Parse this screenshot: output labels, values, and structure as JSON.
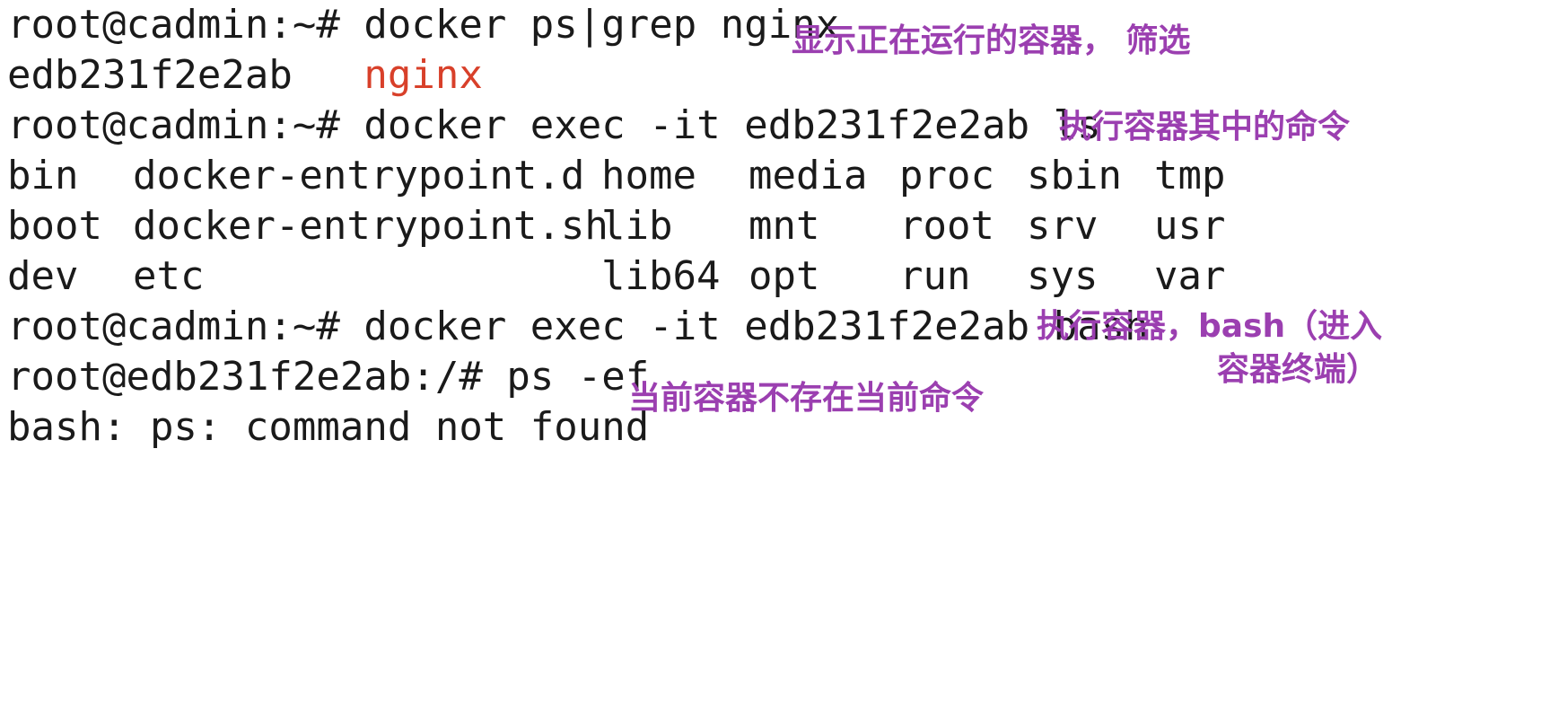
{
  "colors": {
    "background": "#ffffff",
    "terminal_text": "#1a1a1a",
    "grep_highlight": "#d8402a",
    "annotation": "#9b3fb0"
  },
  "terminal": {
    "cmd1": {
      "prompt": "root@cadmin:~#",
      "command": "docker ps|grep nginx"
    },
    "out1": {
      "container_id": "edb231f2e2ab",
      "match": "nginx"
    },
    "cmd2": {
      "prompt": "root@cadmin:~#",
      "command": "docker exec -it edb231f2e2ab ls"
    },
    "ls_rows": [
      [
        "bin",
        "docker-entrypoint.d",
        "home",
        "media",
        "proc",
        "sbin",
        "tmp"
      ],
      [
        "boot",
        "docker-entrypoint.sh",
        "lib",
        "mnt",
        "root",
        "srv",
        "usr"
      ],
      [
        "dev",
        "etc",
        "lib64",
        "opt",
        "run",
        "sys",
        "var"
      ]
    ],
    "cmd3": {
      "prompt": "root@cadmin:~#",
      "command": "docker exec -it edb231f2e2ab bash"
    },
    "cmd4": {
      "prompt": "root@edb231f2e2ab:/#",
      "command": "ps -ef"
    },
    "err": "bash: ps: command not found"
  },
  "annotations": {
    "ps_grep": "显示正在运行的容器， 筛选",
    "exec_ls": "执行容器其中的命令",
    "exec_bash_1": "执行容器，bash（进入",
    "exec_bash_2": "容器终端）",
    "not_found": "当前容器不存在当前命令"
  }
}
